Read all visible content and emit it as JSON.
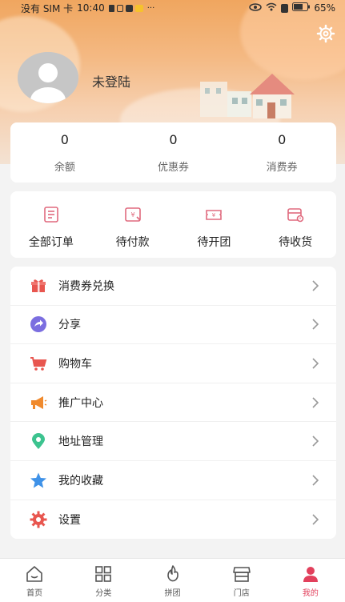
{
  "status_bar": {
    "carrier": "没有 SIM 卡",
    "time": "10:40",
    "more": "···",
    "battery": "65%"
  },
  "profile": {
    "login_text": "未登陆"
  },
  "wallet": [
    {
      "value": "0",
      "label": "余额"
    },
    {
      "value": "0",
      "label": "优惠券"
    },
    {
      "value": "0",
      "label": "消费券"
    }
  ],
  "orders": [
    {
      "label": "全部订单",
      "icon": "order-list-icon"
    },
    {
      "label": "待付款",
      "icon": "payment-icon"
    },
    {
      "label": "待开团",
      "icon": "group-ticket-icon"
    },
    {
      "label": "待收货",
      "icon": "delivery-icon"
    }
  ],
  "menu": [
    {
      "label": "消费券兑换",
      "icon": "gift-icon",
      "color": "#e8564f"
    },
    {
      "label": "分享",
      "icon": "share-icon",
      "color": "#7b6ee0"
    },
    {
      "label": "购物车",
      "icon": "cart-icon",
      "color": "#e8564f"
    },
    {
      "label": "推广中心",
      "icon": "megaphone-icon",
      "color": "#f08a2d"
    },
    {
      "label": "地址管理",
      "icon": "location-icon",
      "color": "#3cc38f"
    },
    {
      "label": "我的收藏",
      "icon": "star-icon",
      "color": "#3f92e8"
    },
    {
      "label": "设置",
      "icon": "gear-icon",
      "color": "#e8564f"
    }
  ],
  "tabs": [
    {
      "label": "首页",
      "icon": "home-icon"
    },
    {
      "label": "分类",
      "icon": "category-icon"
    },
    {
      "label": "拼团",
      "icon": "flame-icon"
    },
    {
      "label": "门店",
      "icon": "store-icon"
    },
    {
      "label": "我的",
      "icon": "user-icon"
    }
  ],
  "colors": {
    "accent": "#e2405c",
    "header_top": "#f0a65f",
    "background": "#f3f3f3"
  }
}
